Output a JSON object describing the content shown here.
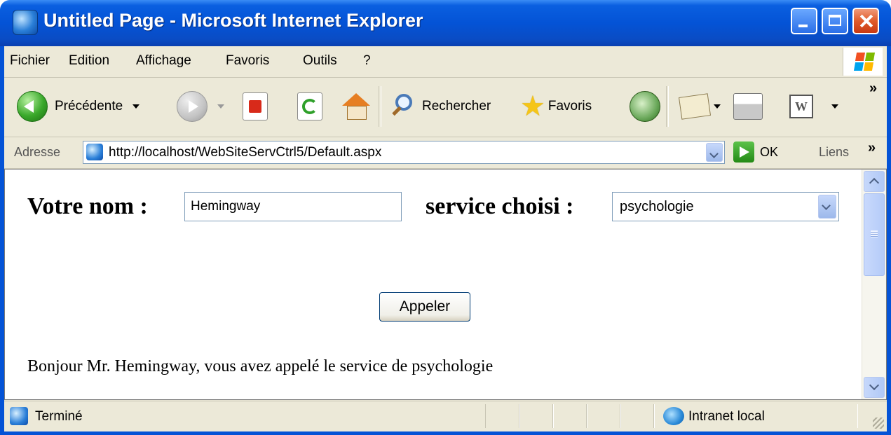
{
  "window": {
    "title": "Untitled Page - Microsoft Internet Explorer"
  },
  "menu": {
    "items": [
      {
        "label": "Fichier",
        "access_key": "F"
      },
      {
        "label": "Edition",
        "access_key": "E"
      },
      {
        "label": "Affichage",
        "access_key": "A"
      },
      {
        "label": "Favoris",
        "access_key": "v"
      },
      {
        "label": "Outils",
        "access_key": "O"
      },
      {
        "label": "?",
        "access_key": "?"
      }
    ]
  },
  "toolbar": {
    "back_label": "Précédente",
    "search_label": "Rechercher",
    "favorites_label": "Favoris",
    "word_icon_letter": "W"
  },
  "address": {
    "label": "Adresse",
    "url": "http://localhost/WebSiteServCtrl5/Default.aspx",
    "go_label": "OK",
    "links_label": "Liens"
  },
  "form": {
    "name_label": "Votre nom :",
    "name_value": "Hemingway",
    "service_label": "service choisi :",
    "service_value": "psychologie",
    "call_button": "Appeler",
    "result_text": "Bonjour Mr. Hemingway, vous avez appelé le service de psychologie"
  },
  "status": {
    "text": "Terminé",
    "zone": "Intranet local"
  },
  "colors": {
    "titlebar": "#0453d6",
    "chrome": "#ece9d8",
    "close_button": "#e05a2a"
  },
  "icons": [
    "ie-icon",
    "minimize-icon",
    "maximize-icon",
    "close-icon",
    "windows-logo-icon",
    "back-arrow-icon",
    "forward-arrow-icon",
    "stop-icon",
    "refresh-icon",
    "home-icon",
    "search-icon",
    "star-icon",
    "history-icon",
    "mail-icon",
    "print-icon",
    "word-icon",
    "go-arrow-icon",
    "intranet-zone-icon"
  ]
}
